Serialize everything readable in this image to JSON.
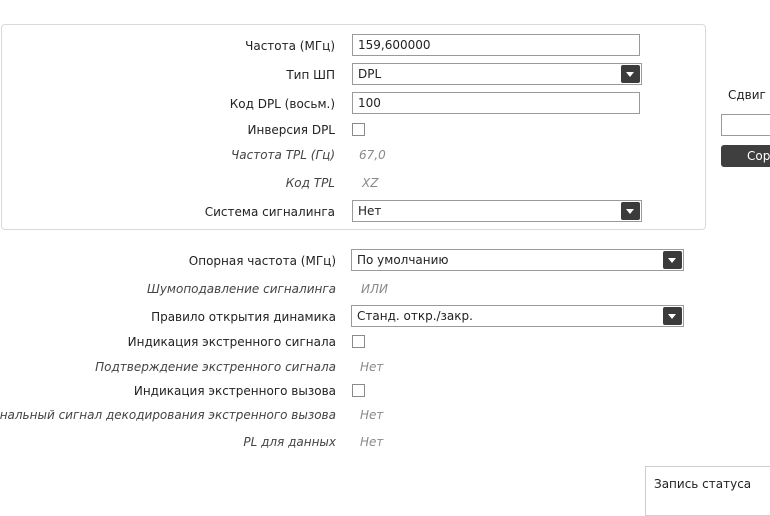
{
  "panel": {
    "frequency": {
      "label": "Частота (МГц)",
      "value": "159,600000"
    },
    "squelch_type": {
      "label": "Тип ШП",
      "value": "DPL"
    },
    "dpl_code": {
      "label": "Код DPL (восьм.)",
      "value": "100"
    },
    "dpl_inversion": {
      "label": "Инверсия DPL",
      "checked": false
    },
    "tpl_frequency": {
      "label": "Частота TPL (Гц)",
      "value": "67,0"
    },
    "tpl_code": {
      "label": "Код TPL",
      "value": "XZ"
    },
    "signaling_system": {
      "label": "Система сигналинга",
      "value": "Нет"
    }
  },
  "settings": {
    "reference_frequency": {
      "label": "Опорная частота (МГц)",
      "value": "По умолчанию"
    },
    "signaling_squelch": {
      "label": "Шумоподавление сигналинга",
      "value": "ИЛИ"
    },
    "speaker_open_rule": {
      "label": "Правило открытия динамика",
      "value": "Станд. откр./закр."
    },
    "emergency_signal_indication": {
      "label": "Индикация экстренного сигнала",
      "checked": false
    },
    "emergency_signal_confirm": {
      "label": "Подтверждение экстренного сигнала",
      "value": "Нет"
    },
    "emergency_call_indication": {
      "label": "Индикация экстренного вызова",
      "checked": false
    },
    "emergency_call_tone": {
      "label": "Тональный сигнал декодирования экстренного вызова",
      "value": "Нет"
    },
    "pl_for_data": {
      "label": "PL для данных",
      "value": "Нет"
    }
  },
  "side": {
    "shift_label": "Сдвиг (М",
    "shift_value": "",
    "button_label": "Сор"
  },
  "status": {
    "label": "Запись статуса"
  }
}
